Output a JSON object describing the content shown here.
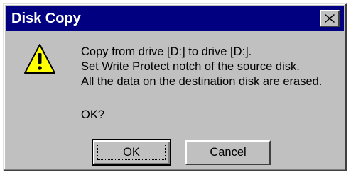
{
  "window": {
    "title": "Disk Copy",
    "close_icon": "close-icon"
  },
  "icon": {
    "name": "warning-icon",
    "color": "#ffff00"
  },
  "message": {
    "lines": [
      "Copy from drive [D:] to drive [D:].",
      "Set Write Protect notch of the source disk.",
      "All the data on the destination disk are erased."
    ],
    "question": "OK?"
  },
  "buttons": {
    "ok_label": "OK",
    "cancel_label": "Cancel"
  },
  "colors": {
    "titlebar": "#000080",
    "face": "#c0c0c0"
  }
}
